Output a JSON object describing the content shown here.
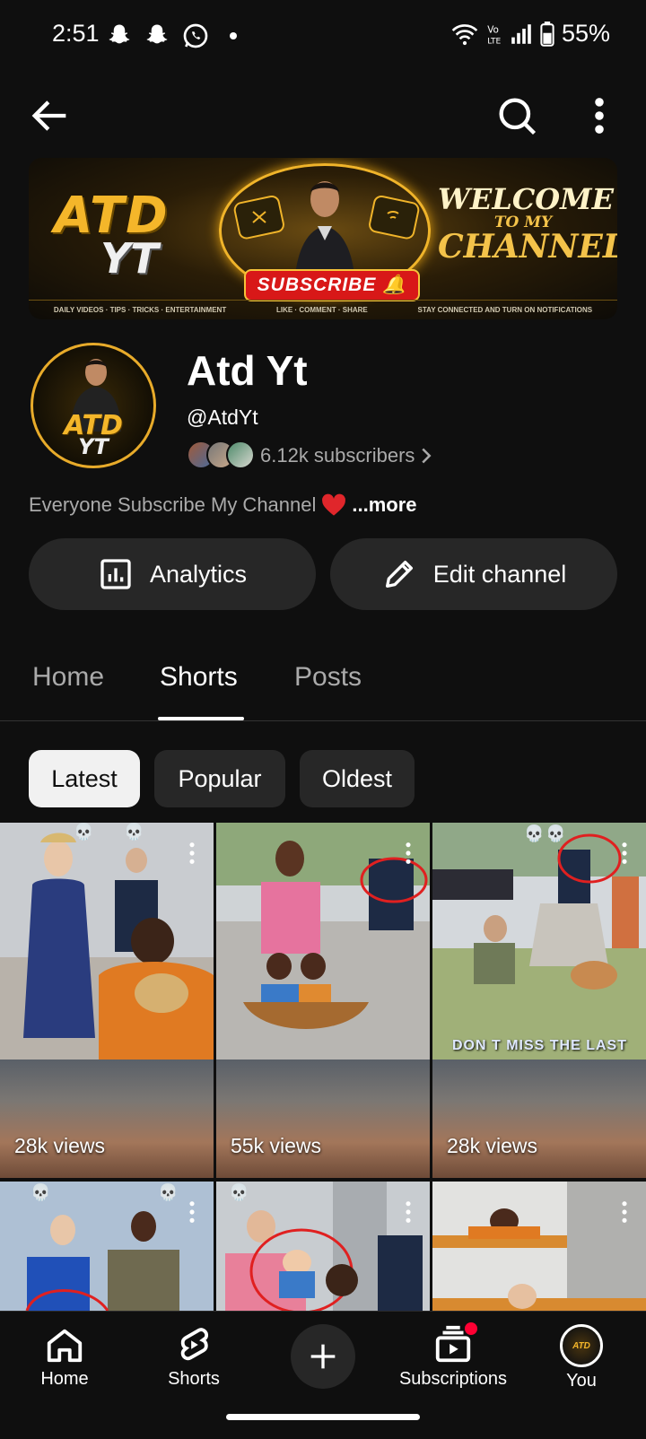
{
  "status_bar": {
    "time": "2:51",
    "battery": "55%"
  },
  "banner": {
    "atd": "ATD",
    "yt": "YT",
    "subscribe": "SUBSCRIBE",
    "welcome_1": "WELCOME",
    "welcome_2": "TO MY",
    "welcome_3": "CHANNEL",
    "footer_left": "DAILY VIDEOS · TIPS · TRICKS · ENTERTAINMENT",
    "footer_mid": "LIKE · COMMENT · SHARE",
    "footer_right": "STAY CONNECTED AND TURN ON NOTIFICATIONS"
  },
  "channel": {
    "avatar_text_1": "ATD",
    "avatar_text_2": "YT",
    "name": "Atd Yt",
    "handle": "@AtdYt",
    "subscribers": "6.12k subscribers",
    "description": "Everyone Subscribe My Channel",
    "more_label": "...more"
  },
  "actions": {
    "analytics": "Analytics",
    "edit_channel": "Edit channel"
  },
  "tabs": [
    "Home",
    "Shorts",
    "Posts"
  ],
  "chips": [
    "Latest",
    "Popular",
    "Oldest"
  ],
  "shorts": [
    {
      "views": "28k views"
    },
    {
      "views": "55k views"
    },
    {
      "views": "28k views",
      "overlay": "DON T MISS THE LAST"
    },
    {
      "views": ""
    },
    {
      "views": ""
    },
    {
      "views": ""
    }
  ],
  "bottom_nav": {
    "home": "Home",
    "shorts": "Shorts",
    "subscriptions": "Subscriptions",
    "you": "You",
    "you_avatar_text": "ATD"
  },
  "colors": {
    "background": "#0f0f0f",
    "surface": "#272727",
    "accent_gold": "#f4b62a",
    "notification_dot": "#ff0033"
  }
}
